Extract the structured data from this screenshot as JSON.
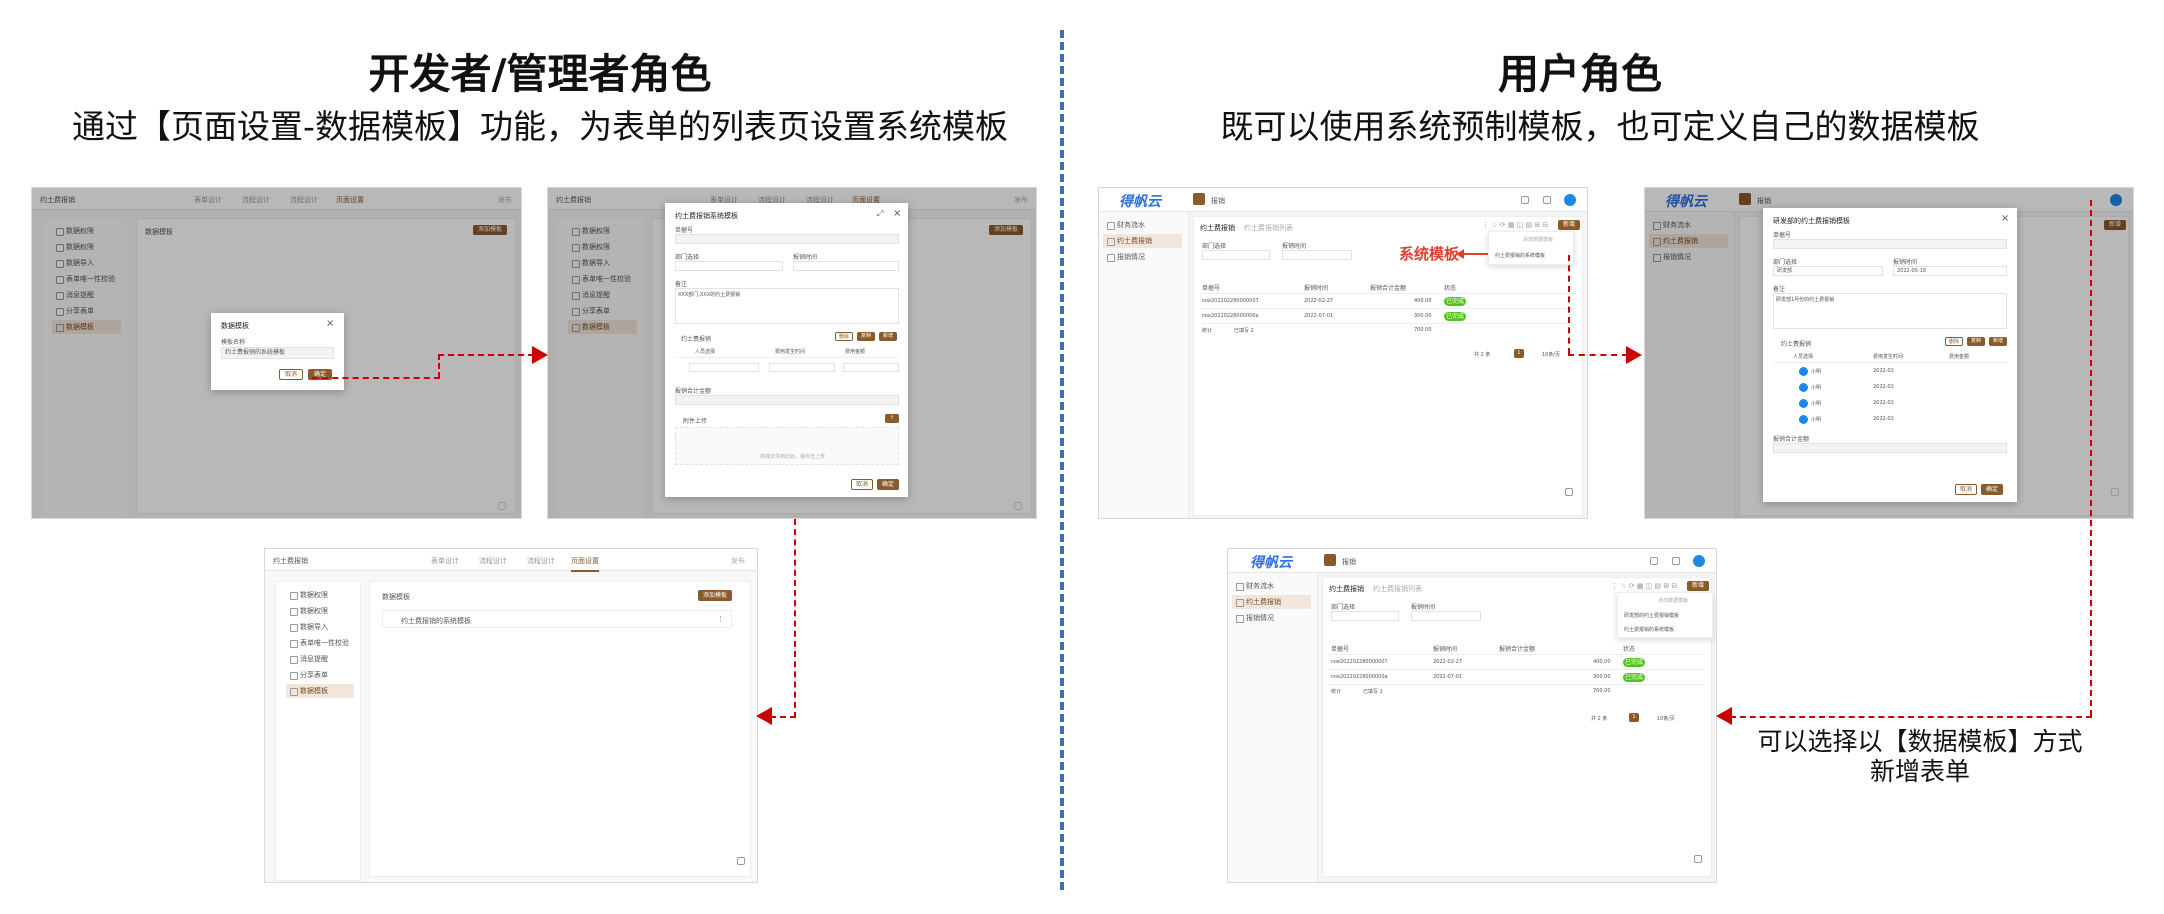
{
  "left": {
    "title": "开发者/管理者角色",
    "subtitle": "通过【页面设置-数据模板】功能，为表单的列表页设置系统模板"
  },
  "right": {
    "title": "用户角色",
    "subtitle": "既可以使用系统预制模板，也可定义自己的数据模板"
  },
  "callout_system": "系统模板",
  "callout_select": "可以选择以【数据模板】方式\n新增表单",
  "app": {
    "form_title": "约土费报销",
    "tabs": [
      "表单设计",
      "流程设计",
      "流程设计",
      "页面设置"
    ],
    "publish": "发布",
    "nav_items": [
      "数据权限",
      "数据权限",
      "数据导入",
      "表单唯一性校验",
      "消息提醒",
      "分享表单",
      "数据模板"
    ],
    "section": "数据模板",
    "add_template": "添加模板",
    "template_row": "约土费报销的系统模板"
  },
  "dialog_small": {
    "title": "数据模板",
    "label": "模板名称",
    "value": "约土费报销的系统模板",
    "cancel": "取消",
    "ok": "确定"
  },
  "dialog_big": {
    "title": "约土费报销系统模板",
    "f1": "单据号",
    "f2": "部门选择",
    "f3": "报销时间",
    "f4": "备注",
    "note": "XXX部门,XXX的约土费报销",
    "detail": "约土费报销",
    "detail_cols": [
      "人员选择",
      "费用发生时间",
      "费用金额"
    ],
    "total_label": "报销合计金额",
    "upload": "附件上传",
    "upload_hint": "拖拽文件到此处，或点击上传",
    "cancel": "取消",
    "ok": "确定",
    "del": "删除",
    "copy": "复制",
    "add": "新增"
  },
  "user": {
    "logo": "得帆云",
    "crumb": "报销",
    "side": [
      "财务流水",
      "约土费报销",
      "报销情况"
    ],
    "tab1": "约土费报销",
    "tab2": "约土费报销列表",
    "new": "新增",
    "filter1": "部门选择",
    "filter2": "报销时间",
    "cols": [
      "单据号",
      "报销时间",
      "报销合计金额",
      "状态"
    ],
    "rows": [
      {
        "no": "rxw202202280000007",
        "date": "2022-02-27",
        "amt": "400.00",
        "status": "已完成"
      },
      {
        "no": "rxw20220228000000a",
        "date": "2022-07-01",
        "amt": "300.00",
        "status": "已完成"
      }
    ],
    "sum_label": "统计",
    "sum_count": "已填写 2",
    "sum_amt": "700.00",
    "pager": "共 2 条",
    "page": "1",
    "per_page": "10条/页",
    "tpl_menu": [
      "添加数据模板",
      "约土费报销的系统模板"
    ],
    "tpl_menu_user": [
      "添加数据模板",
      "研发部的约土费报销模板",
      "约土费报销的系统模板"
    ],
    "modal_title": "研发部的约土费报销模板",
    "dept": "研发部",
    "date": "2022-05-18",
    "note": "研发部1月份的约土费报销",
    "people": [
      "小明",
      "小明",
      "小明",
      "小明"
    ],
    "dates": [
      "2022-02",
      "2022-02",
      "2022-02",
      "2022-02"
    ]
  }
}
